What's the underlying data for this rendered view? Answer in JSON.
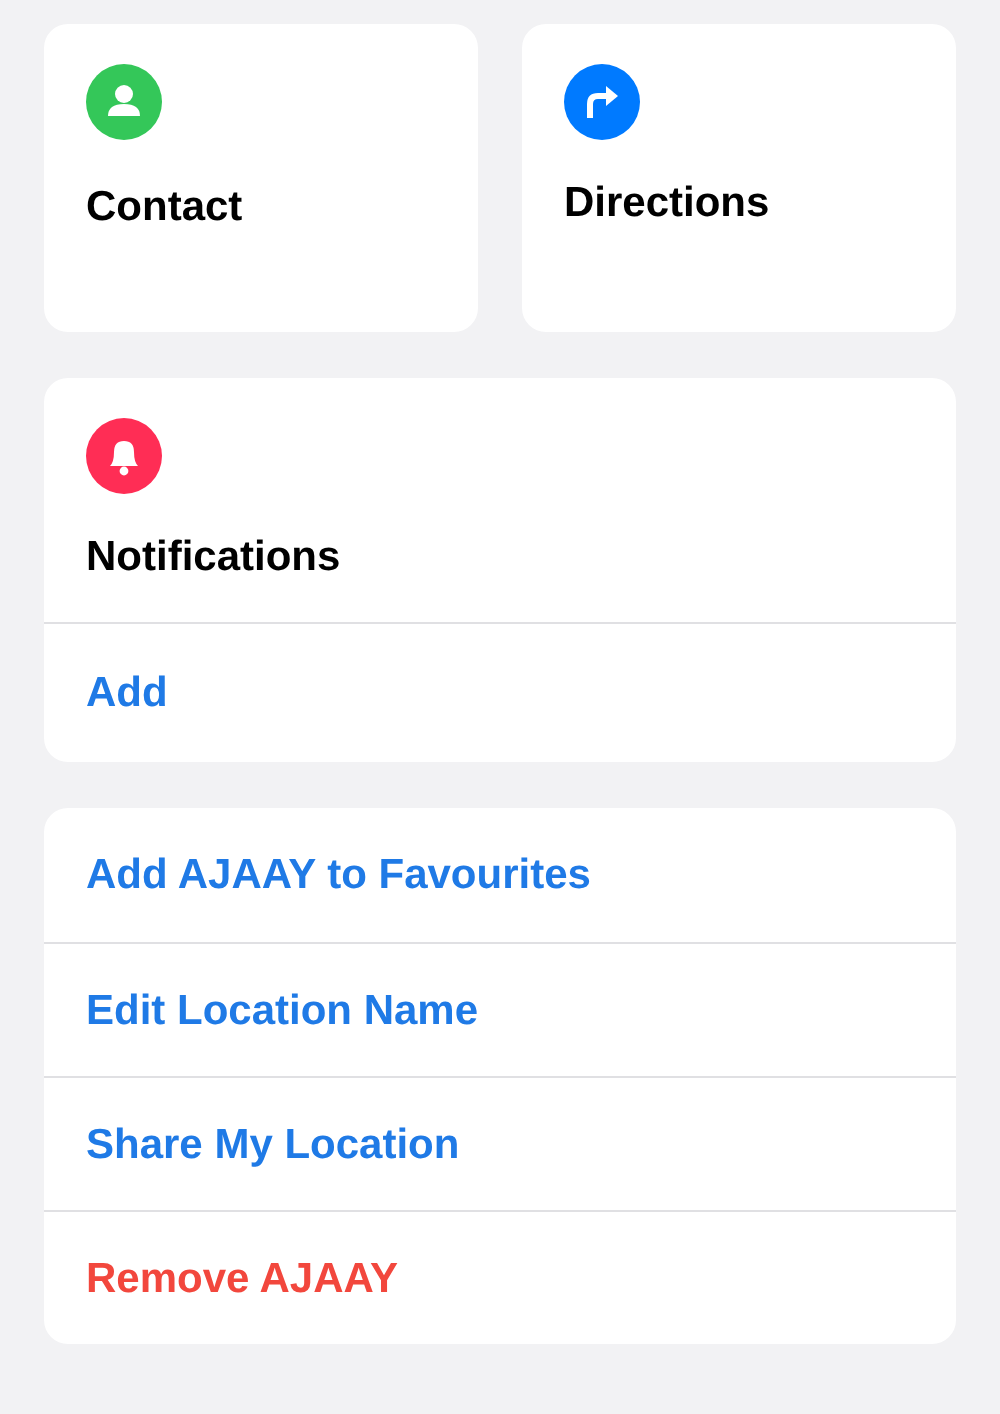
{
  "tiles": [
    {
      "title": "Contact",
      "kind": "contact",
      "color": "#34c759"
    },
    {
      "title": "Directions",
      "kind": "directions",
      "color": "#007aff"
    }
  ],
  "notifications": {
    "title": "Notifications",
    "color": "#ff2d55",
    "action": "Add"
  },
  "actions": [
    {
      "label": "Add AJAAY to Favourites",
      "kind": "normal"
    },
    {
      "label": "Edit Location Name",
      "kind": "normal"
    },
    {
      "label": "Share My Location",
      "kind": "normal"
    },
    {
      "label": "Remove AJAAY",
      "kind": "destructive"
    }
  ]
}
